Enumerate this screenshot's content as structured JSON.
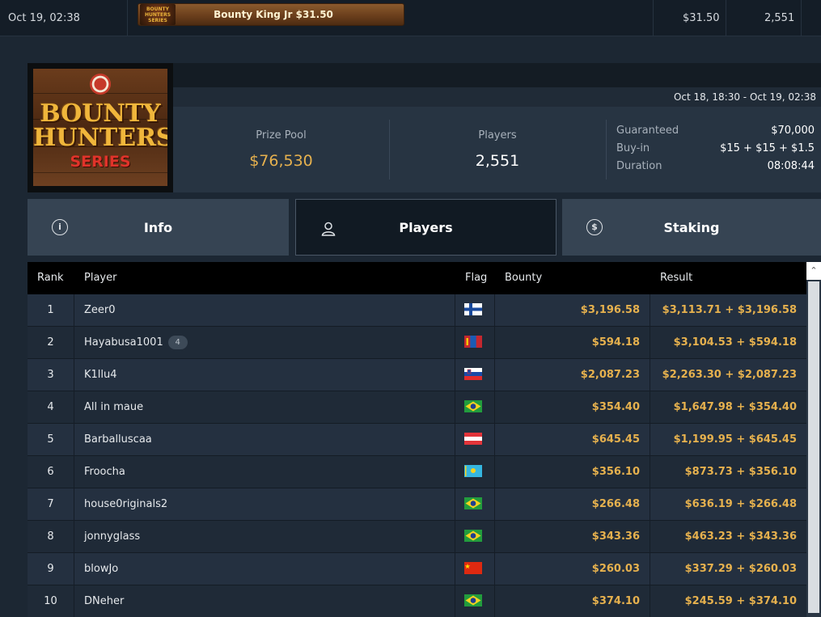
{
  "top_row": {
    "date": "Oct 19, 02:38",
    "banner_logo_text": "BOUNTY HUNTERS SERIES",
    "tournament_name": "Bounty King Jr $31.50",
    "buyin": "$31.50",
    "players": "2,551"
  },
  "header": {
    "logo": {
      "line1": "BOUNTY",
      "line2": "HUNTERS",
      "line3": "SERIES"
    },
    "date_range": "Oct 18, 18:30 - Oct 19, 02:38",
    "prize_pool_label": "Prize Pool",
    "prize_pool_value": "$76,530",
    "players_label": "Players",
    "players_value": "2,551",
    "meta": [
      {
        "key": "Guaranteed",
        "value": "$70,000"
      },
      {
        "key": "Buy-in",
        "value": "$15 + $15 + $1.5"
      },
      {
        "key": "Duration",
        "value": "08:08:44"
      }
    ]
  },
  "tabs": [
    {
      "label": "Info",
      "icon": "info-icon",
      "active": false
    },
    {
      "label": "Players",
      "icon": "user-icon",
      "active": true
    },
    {
      "label": "Staking",
      "icon": "dollar-cycle-icon",
      "active": false
    }
  ],
  "table": {
    "columns": {
      "rank": "Rank",
      "player": "Player",
      "flag": "Flag",
      "bounty": "Bounty",
      "result": "Result"
    },
    "rows": [
      {
        "rank": "1",
        "player": "Zeer0",
        "badge": "",
        "flag": "finland",
        "bounty": "$3,196.58",
        "result": "$3,113.71 + $3,196.58"
      },
      {
        "rank": "2",
        "player": "Hayabusa1001",
        "badge": "4",
        "flag": "mongolia",
        "bounty": "$594.18",
        "result": "$3,104.53 + $594.18"
      },
      {
        "rank": "3",
        "player": "K1llu4",
        "badge": "",
        "flag": "slovenia",
        "bounty": "$2,087.23",
        "result": "$2,263.30 + $2,087.23"
      },
      {
        "rank": "4",
        "player": "All in maue",
        "badge": "",
        "flag": "brazil",
        "bounty": "$354.40",
        "result": "$1,647.98 + $354.40"
      },
      {
        "rank": "5",
        "player": "Barballuscaa",
        "badge": "",
        "flag": "austria",
        "bounty": "$645.45",
        "result": "$1,199.95 + $645.45"
      },
      {
        "rank": "6",
        "player": "Froocha",
        "badge": "",
        "flag": "kazakhstan",
        "bounty": "$356.10",
        "result": "$873.73 + $356.10"
      },
      {
        "rank": "7",
        "player": "house0riginals2",
        "badge": "",
        "flag": "brazil",
        "bounty": "$266.48",
        "result": "$636.19 + $266.48"
      },
      {
        "rank": "8",
        "player": "jonnyglass",
        "badge": "",
        "flag": "brazil",
        "bounty": "$343.36",
        "result": "$463.23 + $343.36"
      },
      {
        "rank": "9",
        "player": "blowJo",
        "badge": "",
        "flag": "china",
        "bounty": "$260.03",
        "result": "$337.29 + $260.03"
      },
      {
        "rank": "10",
        "player": "DNeher",
        "badge": "",
        "flag": "brazil",
        "bounty": "$374.10",
        "result": "$245.59 + $374.10"
      }
    ]
  },
  "colors": {
    "gold": "#e6b14e",
    "bg": "#1c2733",
    "tab_bg": "#364453",
    "active_tab_bg": "#111a23"
  }
}
